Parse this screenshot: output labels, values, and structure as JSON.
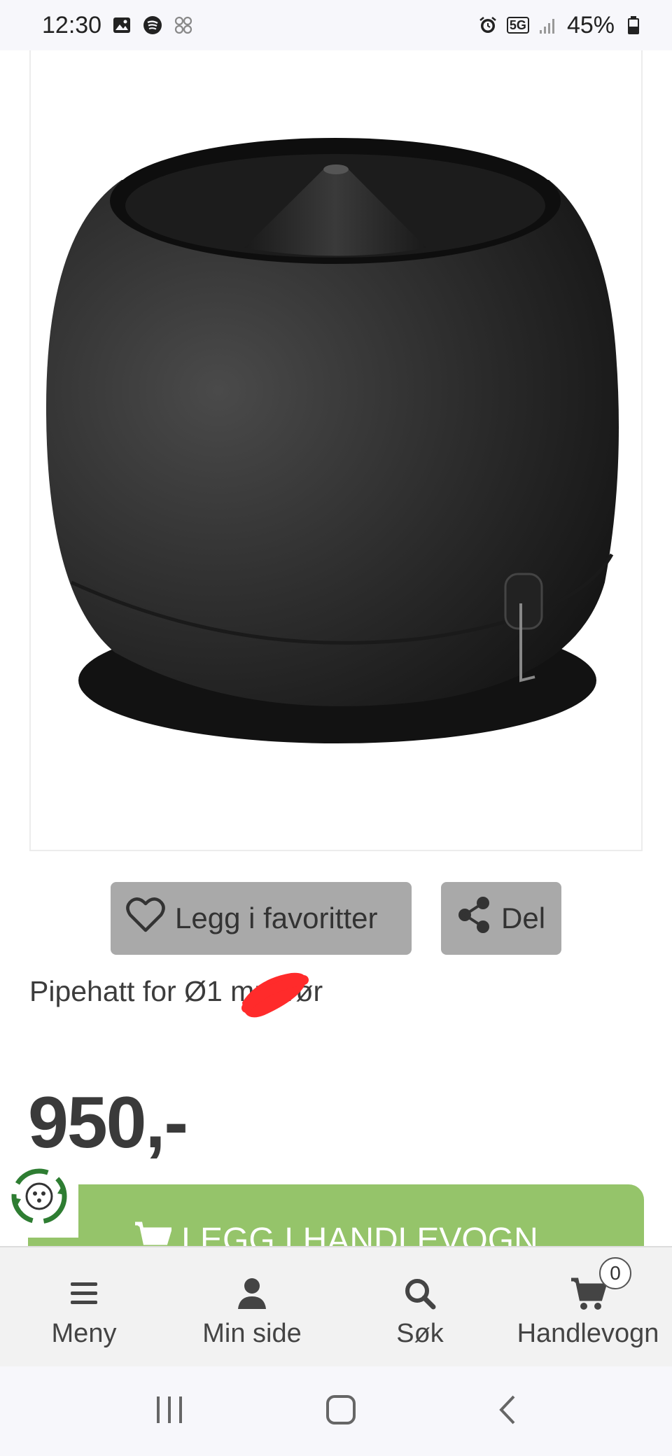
{
  "status_bar": {
    "time": "12:30",
    "network": "5G",
    "battery": "45%",
    "icons": [
      "gallery-icon",
      "spotify-icon",
      "apps-icon",
      "alarm-icon",
      "signal-icon",
      "battery-icon"
    ]
  },
  "product": {
    "image_alt": "black-pipe-hat-product-image",
    "title": "Pipehatt for Ø1    mm rør",
    "price": "950,-"
  },
  "actions": {
    "favorite_label": "Legg i favoritter",
    "share_label": "Del"
  },
  "cart_button": {
    "label": "LEGG I HANDLEVOGN"
  },
  "bottom_nav": {
    "items": [
      {
        "label": "Meny",
        "icon": "menu-icon"
      },
      {
        "label": "Min side",
        "icon": "user-icon"
      },
      {
        "label": "Søk",
        "icon": "search-icon"
      },
      {
        "label": "Handlevogn",
        "icon": "cart-icon",
        "badge": "0"
      }
    ]
  },
  "colors": {
    "accent_green": "#95c46a",
    "button_grey": "#a9a9a9",
    "redaction": "#ff2b2b"
  }
}
